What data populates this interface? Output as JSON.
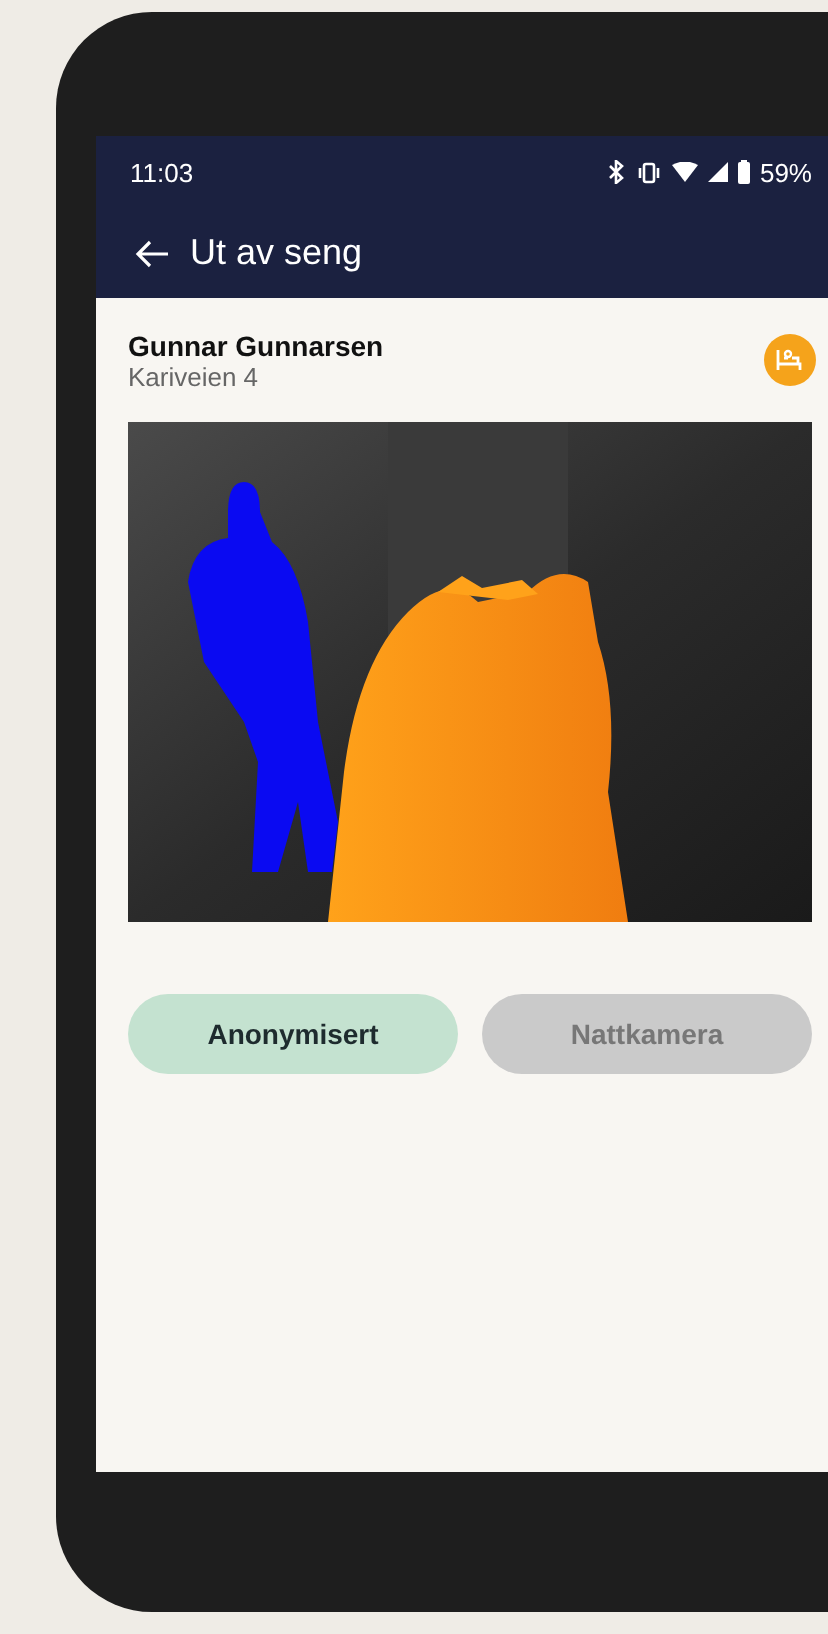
{
  "status_bar": {
    "time": "11:03",
    "battery": "59%"
  },
  "app_bar": {
    "title": "Ut av seng"
  },
  "resident": {
    "name": "Gunnar Gunnarsen",
    "address": "Kariveien 4"
  },
  "modes": [
    {
      "label": "Anonymisert",
      "selected": true
    },
    {
      "label": "Nattkamera",
      "selected": false
    }
  ]
}
